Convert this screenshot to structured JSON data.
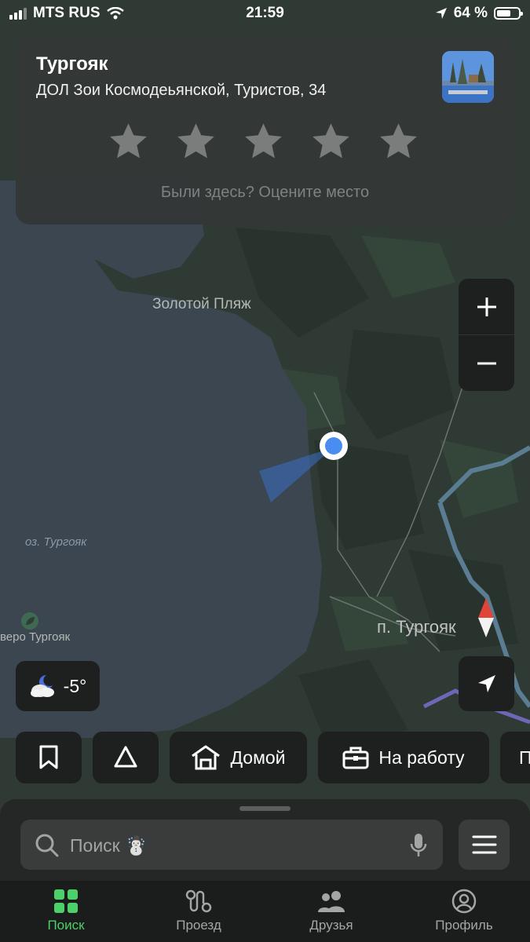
{
  "status_bar": {
    "carrier": "MTS RUS",
    "time": "21:59",
    "battery": "64 %",
    "battery_level": 0.64
  },
  "place_card": {
    "title": "Тургояк",
    "address": "ДОЛ Зои Космодеьянской, Туристов, 34",
    "rating_stars": 5,
    "rate_hint": "Были здесь? Оцените место"
  },
  "map": {
    "labels": {
      "beach": "Золотой Пляж",
      "lake": "оз. Тургояк",
      "village": "п. Тургояк",
      "poi": "веро Тургояк"
    }
  },
  "weather": {
    "temperature": "-5°",
    "icon": "partly-cloudy-night-icon"
  },
  "quick_actions": [
    {
      "icon": "bookmark-icon",
      "label": ""
    },
    {
      "icon": "route-triangle-icon",
      "label": ""
    },
    {
      "icon": "home-icon",
      "label": "Домой"
    },
    {
      "icon": "briefcase-icon",
      "label": "На работу"
    },
    {
      "icon": "more-icon",
      "label": "П"
    }
  ],
  "search": {
    "placeholder": "Поиск",
    "emoji": "☃️"
  },
  "tabs": [
    {
      "label": "Поиск",
      "icon": "grid-icon",
      "active": true
    },
    {
      "label": "Проезд",
      "icon": "route-icon",
      "active": false
    },
    {
      "label": "Друзья",
      "icon": "friends-icon",
      "active": false
    },
    {
      "label": "Профиль",
      "icon": "profile-icon",
      "active": false
    }
  ],
  "colors": {
    "accent": "#4cd06a",
    "location_dot": "#4a8df0",
    "water": "#3b4650",
    "forest": "#2f3d34"
  }
}
